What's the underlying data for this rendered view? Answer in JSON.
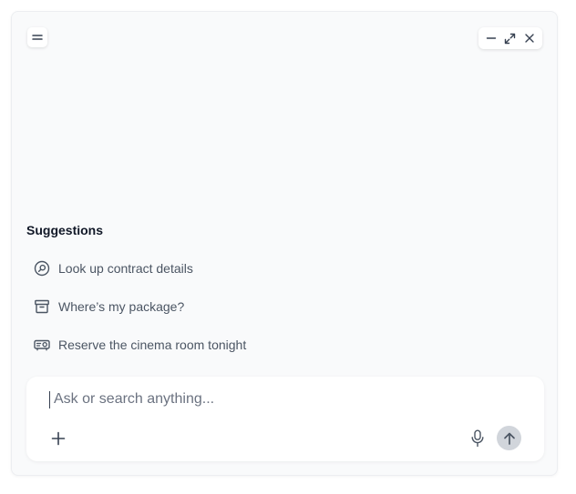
{
  "header": {
    "menu_icon": "menu-icon",
    "controls": [
      "minimize-icon",
      "expand-icon",
      "close-icon"
    ]
  },
  "suggestions": {
    "title": "Suggestions",
    "items": [
      {
        "label": "Look up contract details",
        "icon": "search-icon"
      },
      {
        "label": "Where’s my package?",
        "icon": "archive-box-icon"
      },
      {
        "label": "Reserve the cinema room tonight",
        "icon": "projector-icon"
      }
    ]
  },
  "composer": {
    "placeholder": "Ask or search anything...",
    "value": "",
    "attach_icon": "plus-icon",
    "mic_icon": "microphone-icon",
    "send_icon": "arrow-up-icon"
  },
  "colors": {
    "panel_bg": "#f9fafb",
    "text_primary": "#111827",
    "text_secondary": "#4b5563",
    "send_bg": "#d1d5db"
  }
}
